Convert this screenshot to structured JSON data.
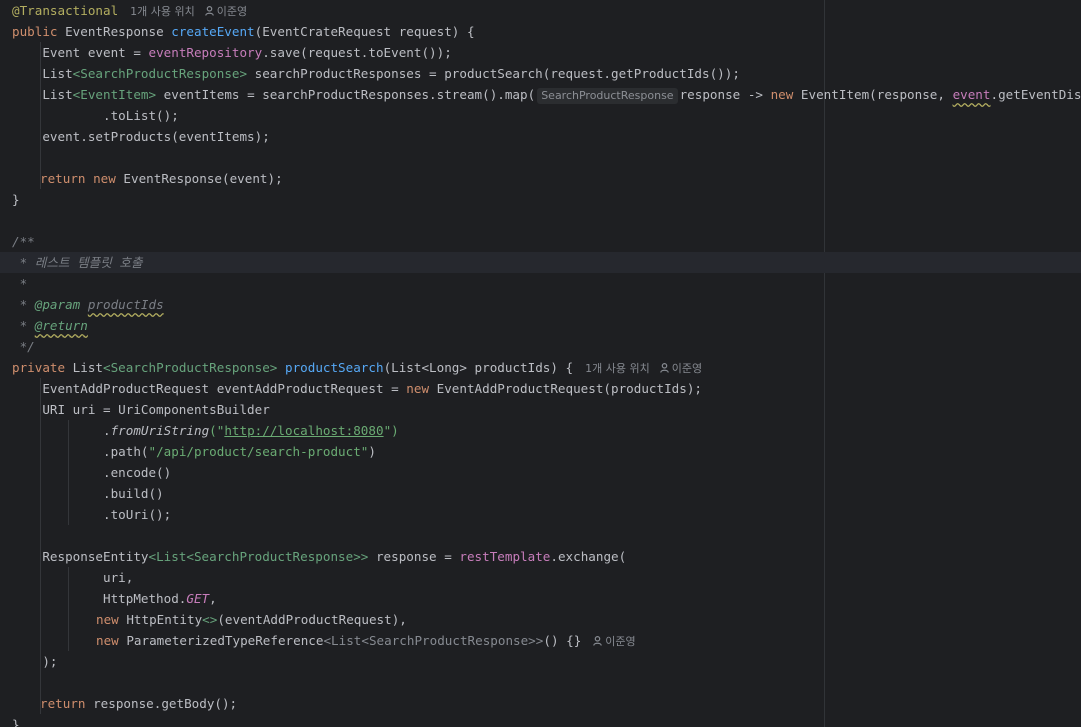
{
  "hints": {
    "usage": "1개 사용 위치",
    "author": "이준영"
  },
  "inlay": {
    "lambda_param_type": "SearchProductResponse"
  },
  "code": {
    "l1_annotation": "@Transactional",
    "l2_public": "public",
    "l2_type": " EventResponse ",
    "l2_method": "createEvent",
    "l2_params": "(EventCrateRequest request) {",
    "l3_a": "    Event event = ",
    "l3_field": "eventRepository",
    "l3_b": ".save(request.toEvent());",
    "l4_a": "    List",
    "l4_b": "<SearchProductResponse>",
    "l4_c": " searchProductResponses = productSearch(request.getProductIds());",
    "l5_a": "    List",
    "l5_b": "<EventItem>",
    "l5_c": " eventItems = searchProductResponses.stream().map(",
    "l5_d": "response -> ",
    "l5_new": "new",
    "l5_e": " EventItem(response, ",
    "l5_event": "event",
    "l5_f": ".getEventDiscount()))",
    "l6": "            .toList();",
    "l7": "    event.setProducts(eventItems);",
    "l9_return": "return",
    "l9_new": "new",
    "l9_rest": " EventResponse(event);",
    "l10": "}",
    "l12": "/**",
    "l13": " * 레스트 템플릿 호출",
    "l14": " *",
    "l15_star": " * ",
    "l15_tag": "@param",
    "l15_name": "productIds",
    "l16_star": " * ",
    "l16_tag": "@return",
    "l17": " */",
    "l18_private": "private",
    "l18_a": " List",
    "l18_b": "<SearchProductResponse>",
    "l18_method": "productSearch",
    "l18_params": "(List<Long> productIds) {",
    "l19_a": "    EventAddProductRequest eventAddProductRequest = ",
    "l19_new": "new",
    "l19_b": " EventAddProductRequest(productIds);",
    "l20": "    URI uri = UriComponentsBuilder",
    "l21_a": "            .",
    "l21_method": "fromUriString",
    "l21_b": "(\"",
    "l21_url": "http://localhost:8080",
    "l21_c": "\")",
    "l22_a": "            .path(",
    "l22_str": "\"/api/product/search-product\"",
    "l22_b": ")",
    "l23": "            .encode()",
    "l24": "            .build()",
    "l25": "            .toUri();",
    "l27_a": "    ResponseEntity",
    "l27_b": "<List<SearchProductResponse>>",
    "l27_c": " response = ",
    "l27_field": "restTemplate",
    "l27_d": ".exchange(",
    "l28": "            uri,",
    "l29_a": "            HttpMethod.",
    "l29_const": "GET",
    "l29_b": ",",
    "l30_new": "new",
    "l30_a": " HttpEntity",
    "l30_b": "<>",
    "l30_c": "(eventAddProductRequest),",
    "l31_new": "new",
    "l31_a": " ParameterizedTypeReference",
    "l31_b": "<List<SearchProductResponse>>",
    "l31_c": "() {}",
    "l32": "    );",
    "l34_return": "return",
    "l34_rest": " response.getBody();",
    "l35": "}"
  }
}
